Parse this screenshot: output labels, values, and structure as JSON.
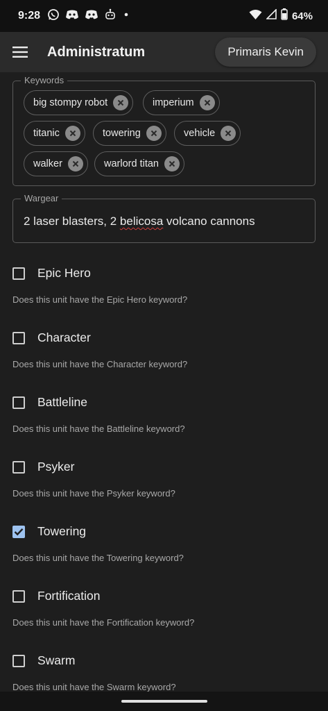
{
  "status_bar": {
    "time": "9:28",
    "battery_percent": "64%",
    "icons": [
      "whatsapp-icon",
      "discord-icon",
      "discord-icon",
      "robot-icon",
      "dot-icon",
      "wifi-icon",
      "signal-icon",
      "battery-icon"
    ]
  },
  "app_bar": {
    "title": "Administratum",
    "user": "Primaris Kevin"
  },
  "keywords": {
    "legend": "Keywords",
    "chips": [
      "big stompy robot",
      "imperium",
      "titanic",
      "towering",
      "vehicle",
      "walker",
      "warlord titan"
    ]
  },
  "wargear": {
    "legend": "Wargear",
    "value_before": "2 laser blasters, 2 ",
    "value_misspelled": "belicosa",
    "value_after": " volcano cannons"
  },
  "checkboxes": [
    {
      "label": "Epic Hero",
      "help": "Does this unit have the Epic Hero keyword?",
      "checked": false
    },
    {
      "label": "Character",
      "help": "Does this unit have the Character keyword?",
      "checked": false
    },
    {
      "label": "Battleline",
      "help": "Does this unit have the Battleline keyword?",
      "checked": false
    },
    {
      "label": "Psyker",
      "help": "Does this unit have the Psyker keyword?",
      "checked": false
    },
    {
      "label": "Towering",
      "help": "Does this unit have the Towering keyword?",
      "checked": true
    },
    {
      "label": "Fortification",
      "help": "Does this unit have the Fortification keyword?",
      "checked": false
    },
    {
      "label": "Swarm",
      "help": "Does this unit have the Swarm keyword?",
      "checked": false
    }
  ],
  "colors": {
    "background": "#1e1e1e",
    "appbar": "#2b2b2b",
    "checked_accent": "#9ec3f0"
  }
}
